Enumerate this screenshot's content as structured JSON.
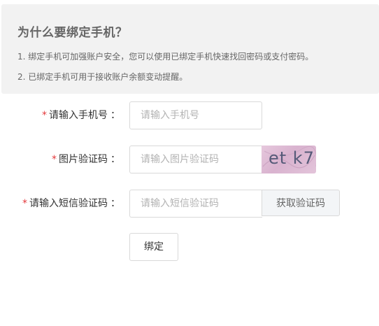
{
  "notice": {
    "title": "为什么要绑定手机？",
    "line1": "1. 绑定手机可加强账户安全，您可以使用已绑定手机快速找回密码或支付密码。",
    "line2": "2. 已绑定手机可用于接收账户余额变动提醒。"
  },
  "form": {
    "required_mark": "*",
    "colon": "：",
    "phone": {
      "label": "请输入手机号",
      "placeholder": "请输入手机号",
      "value": ""
    },
    "image_code": {
      "label": "图片验证码",
      "placeholder": "请输入图片验证码",
      "value": "",
      "captcha_text": "et k7"
    },
    "sms_code": {
      "label": "请输入短信验证码",
      "placeholder": "请输入短信验证码",
      "value": "",
      "send_button": "获取验证码"
    },
    "submit_button": "绑定"
  },
  "colors": {
    "required": "#e4393c",
    "notice_bg": "#f2f2f2",
    "captcha_bg": "#dcb8d2",
    "captcha_text": "#555a78"
  }
}
